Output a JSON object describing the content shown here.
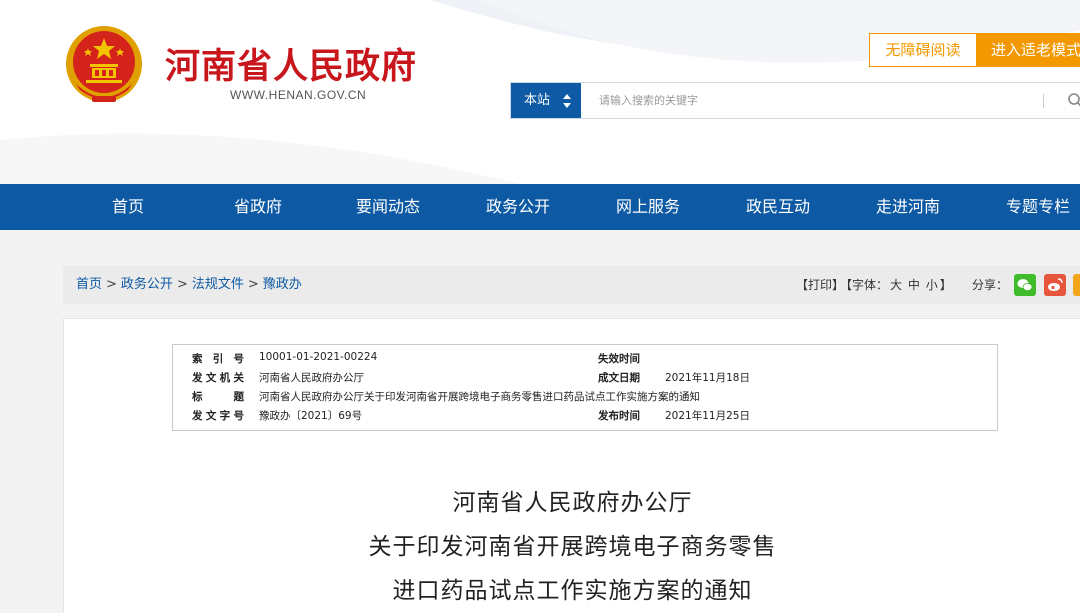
{
  "header": {
    "site_title": "河南省人民政府",
    "site_url": "WWW.HENAN.GOV.CN",
    "accessibility_label": "无障碍阅读",
    "elder_mode_label": "进入适老模式",
    "search": {
      "scope_label": "本站",
      "placeholder": "请输入搜索的关键字"
    }
  },
  "nav": {
    "items": [
      "首页",
      "省政府",
      "要闻动态",
      "政务公开",
      "网上服务",
      "政民互动",
      "走进河南",
      "专题专栏"
    ]
  },
  "breadcrumb": {
    "items": [
      "首页",
      "政务公开",
      "法规文件",
      "豫政办"
    ],
    "separator": ">"
  },
  "tools": {
    "print": "【打印】",
    "font_label": "【字体：",
    "font_large": "大",
    "font_medium": "中",
    "font_small": "小",
    "font_close": "】",
    "share_label": "分享："
  },
  "meta": {
    "index_no_label": "索 引 号",
    "index_no": "10001-01-2021-00224",
    "expiry_label": "失效时间",
    "expiry": "",
    "issuer_label": "发文机关",
    "issuer": "河南省人民政府办公厅",
    "written_date_label": "成文日期",
    "written_date": "2021年11月18日",
    "title_label": "标　　题",
    "title": "河南省人民政府办公厅关于印发河南省开展跨境电子商务零售进口药品试点工作实施方案的通知",
    "doc_no_label": "发文字号",
    "doc_no": "豫政办〔2021〕69号",
    "publish_label": "发布时间",
    "publish": "2021年11月25日"
  },
  "document": {
    "title_lines": [
      "河南省人民政府办公厅",
      "关于印发河南省开展跨境电子商务零售",
      "进口药品试点工作实施方案的通知"
    ]
  },
  "colors": {
    "brand_red": "#c8161d",
    "nav_blue": "#0d59a3",
    "accent_orange": "#f39800"
  }
}
